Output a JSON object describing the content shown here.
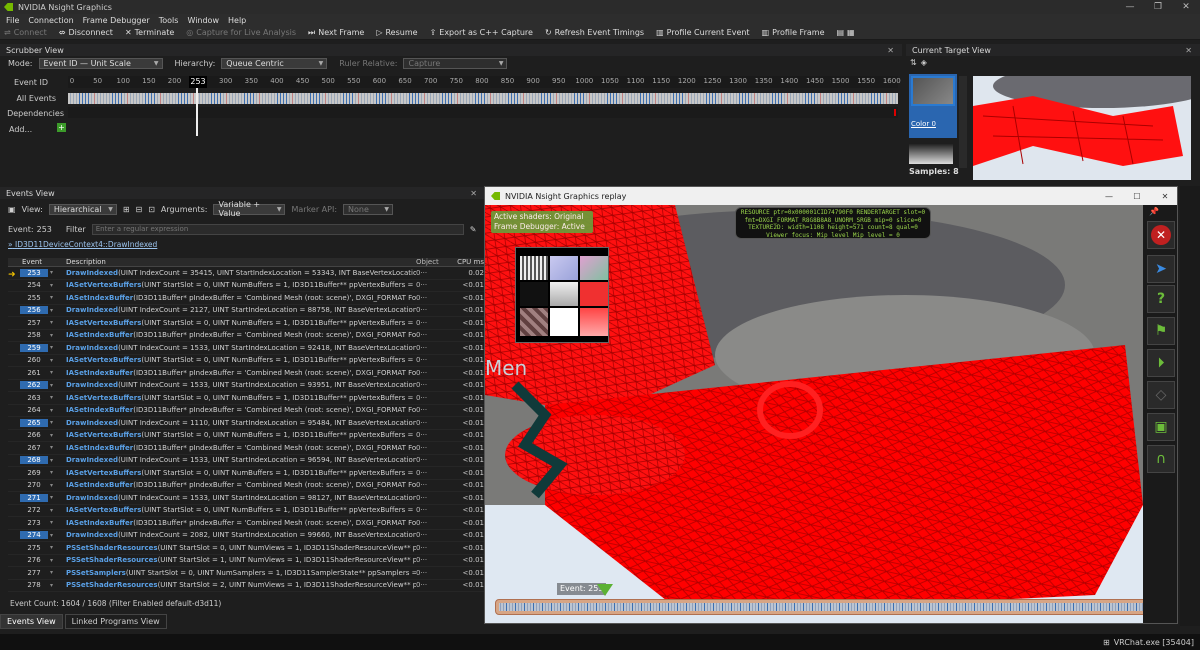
{
  "app": {
    "title": "NVIDIA Nsight Graphics"
  },
  "menu": [
    "File",
    "Connection",
    "Frame Debugger",
    "Tools",
    "Window",
    "Help"
  ],
  "toolbar": {
    "connect": "Connect",
    "disconnect": "Disconnect",
    "terminate": "Terminate",
    "capture": "Capture for Live Analysis",
    "next_frame": "Next Frame",
    "resume": "Resume",
    "export": "Export as C++ Capture",
    "refresh": "Refresh Event Timings",
    "profile_event": "Profile Current Event",
    "profile_frame": "Profile Frame"
  },
  "scrubber": {
    "title": "Scrubber View",
    "mode_label": "Mode:",
    "mode_value": "Event ID — Unit Scale",
    "hierarchy_label": "Hierarchy:",
    "hierarchy_value": "Queue Centric",
    "ruler_label": "Ruler Relative:",
    "ruler_value": "Capture",
    "rows": {
      "event_id": "Event ID",
      "all_events": "All Events",
      "dependencies": "Dependencies",
      "add": "Add..."
    },
    "ticks": [
      "0",
      "50",
      "100",
      "150",
      "200",
      "253",
      "300",
      "350",
      "400",
      "450",
      "500",
      "550",
      "600",
      "650",
      "700",
      "750",
      "800",
      "850",
      "900",
      "950",
      "1000",
      "1050",
      "1100",
      "1150",
      "1200",
      "1250",
      "1300",
      "1350",
      "1400",
      "1450",
      "1500",
      "1550",
      "1600"
    ],
    "current": "253",
    "add_button": "+"
  },
  "current_target": {
    "title": "Current Target View",
    "thumb_label": "Color 0",
    "samples": "Samples: 8"
  },
  "events_view": {
    "title": "Events View",
    "view_label": "View:",
    "view_value": "Hierarchical",
    "args_label": "Arguments:",
    "args_value": "Variable + Value",
    "marker_label": "Marker API:",
    "marker_value": "None",
    "event_label": "Event:",
    "event_value": "253",
    "filter_label": "Filter",
    "filter_placeholder": "Enter a regular expression",
    "breadcrumb": "ID3D11DeviceContext4::DrawIndexed",
    "headers": {
      "event": "Event",
      "desc": "Description",
      "object": "Object",
      "cpu": "CPU ms"
    },
    "rows": [
      {
        "id": "253",
        "sel": true,
        "fn": "DrawIndexed",
        "args": "(UINT IndexCount = 35415, UINT StartIndexLocation = 53343, INT BaseVertexLocation = ···",
        "obj": "0···",
        "cpu": "0.02"
      },
      {
        "id": "254",
        "sel": false,
        "fn": "IASetVertexBuffers",
        "args": "(UINT StartSlot = 0, UINT NumBuffers = 1, ID3D11Buffer** ppVertexBuffers = ···",
        "obj": "0···",
        "cpu": "<0.01"
      },
      {
        "id": "255",
        "sel": false,
        "fn": "IASetIndexBuffer",
        "args": "(ID3D11Buffer* pIndexBuffer = 'Combined Mesh (root: scene)', DXGI_FORMAT For···",
        "obj": "0···",
        "cpu": "<0.01"
      },
      {
        "id": "256",
        "sel": true,
        "fn": "DrawIndexed",
        "args": "(UINT IndexCount = 2127, UINT StartIndexLocation = 88758, INT BaseVertexLocation = ···",
        "obj": "0···",
        "cpu": "<0.01"
      },
      {
        "id": "257",
        "sel": false,
        "fn": "IASetVertexBuffers",
        "args": "(UINT StartSlot = 0, UINT NumBuffers = 1, ID3D11Buffer** ppVertexBuffers = ···",
        "obj": "0···",
        "cpu": "<0.01"
      },
      {
        "id": "258",
        "sel": false,
        "fn": "IASetIndexBuffer",
        "args": "(ID3D11Buffer* pIndexBuffer = 'Combined Mesh (root: scene)', DXGI_FORMAT For···",
        "obj": "0···",
        "cpu": "<0.01"
      },
      {
        "id": "259",
        "sel": true,
        "fn": "DrawIndexed",
        "args": "(UINT IndexCount = 1533, UINT StartIndexLocation = 92418, INT BaseVertexLocation = ···",
        "obj": "0···",
        "cpu": "<0.01"
      },
      {
        "id": "260",
        "sel": false,
        "fn": "IASetVertexBuffers",
        "args": "(UINT StartSlot = 0, UINT NumBuffers = 1, ID3D11Buffer** ppVertexBuffers = ···",
        "obj": "0···",
        "cpu": "<0.01"
      },
      {
        "id": "261",
        "sel": false,
        "fn": "IASetIndexBuffer",
        "args": "(ID3D11Buffer* pIndexBuffer = 'Combined Mesh (root: scene)', DXGI_FORMAT For···",
        "obj": "0···",
        "cpu": "<0.01"
      },
      {
        "id": "262",
        "sel": true,
        "fn": "DrawIndexed",
        "args": "(UINT IndexCount = 1533, UINT StartIndexLocation = 93951, INT BaseVertexLocation = ···",
        "obj": "0···",
        "cpu": "<0.01"
      },
      {
        "id": "263",
        "sel": false,
        "fn": "IASetVertexBuffers",
        "args": "(UINT StartSlot = 0, UINT NumBuffers = 1, ID3D11Buffer** ppVertexBuffers = ···",
        "obj": "0···",
        "cpu": "<0.01"
      },
      {
        "id": "264",
        "sel": false,
        "fn": "IASetIndexBuffer",
        "args": "(ID3D11Buffer* pIndexBuffer = 'Combined Mesh (root: scene)', DXGI_FORMAT For···",
        "obj": "0···",
        "cpu": "<0.01"
      },
      {
        "id": "265",
        "sel": true,
        "fn": "DrawIndexed",
        "args": "(UINT IndexCount = 1110, UINT StartIndexLocation = 95484, INT BaseVertexLocation = ···",
        "obj": "0···",
        "cpu": "<0.01"
      },
      {
        "id": "266",
        "sel": false,
        "fn": "IASetVertexBuffers",
        "args": "(UINT StartSlot = 0, UINT NumBuffers = 1, ID3D11Buffer** ppVertexBuffers = ···",
        "obj": "0···",
        "cpu": "<0.01"
      },
      {
        "id": "267",
        "sel": false,
        "fn": "IASetIndexBuffer",
        "args": "(ID3D11Buffer* pIndexBuffer = 'Combined Mesh (root: scene)', DXGI_FORMAT For···",
        "obj": "0···",
        "cpu": "<0.01"
      },
      {
        "id": "268",
        "sel": true,
        "fn": "DrawIndexed",
        "args": "(UINT IndexCount = 1533, UINT StartIndexLocation = 96594, INT BaseVertexLocation = ···",
        "obj": "0···",
        "cpu": "<0.01"
      },
      {
        "id": "269",
        "sel": false,
        "fn": "IASetVertexBuffers",
        "args": "(UINT StartSlot = 0, UINT NumBuffers = 1, ID3D11Buffer** ppVertexBuffers = ···",
        "obj": "0···",
        "cpu": "<0.01"
      },
      {
        "id": "270",
        "sel": false,
        "fn": "IASetIndexBuffer",
        "args": "(ID3D11Buffer* pIndexBuffer = 'Combined Mesh (root: scene)', DXGI_FORMAT For···",
        "obj": "0···",
        "cpu": "<0.01"
      },
      {
        "id": "271",
        "sel": true,
        "fn": "DrawIndexed",
        "args": "(UINT IndexCount = 1533, UINT StartIndexLocation = 98127, INT BaseVertexLocation = ···",
        "obj": "0···",
        "cpu": "<0.01"
      },
      {
        "id": "272",
        "sel": false,
        "fn": "IASetVertexBuffers",
        "args": "(UINT StartSlot = 0, UINT NumBuffers = 1, ID3D11Buffer** ppVertexBuffers = ···",
        "obj": "0···",
        "cpu": "<0.01"
      },
      {
        "id": "273",
        "sel": false,
        "fn": "IASetIndexBuffer",
        "args": "(ID3D11Buffer* pIndexBuffer = 'Combined Mesh (root: scene)', DXGI_FORMAT For···",
        "obj": "0···",
        "cpu": "<0.01"
      },
      {
        "id": "274",
        "sel": true,
        "fn": "DrawIndexed",
        "args": "(UINT IndexCount = 2082, UINT StartIndexLocation = 99660, INT BaseVertexLocation = ···",
        "obj": "0···",
        "cpu": "<0.01"
      },
      {
        "id": "275",
        "sel": false,
        "fn": "PSSetShaderResources",
        "args": "(UINT StartSlot = 0, UINT NumViews = 1, ID3D11ShaderResourceView** pp···",
        "obj": "0···",
        "cpu": "<0.01"
      },
      {
        "id": "276",
        "sel": false,
        "fn": "PSSetShaderResources",
        "args": "(UINT StartSlot = 1, UINT NumViews = 1, ID3D11ShaderResourceView** pp···",
        "obj": "0···",
        "cpu": "<0.01"
      },
      {
        "id": "277",
        "sel": false,
        "fn": "PSSetSamplers",
        "args": "(UINT StartSlot = 0, UINT NumSamplers = 1, ID3D11SamplerState** ppSamplers = ···",
        "obj": "0···",
        "cpu": "<0.01"
      },
      {
        "id": "278",
        "sel": false,
        "fn": "PSSetShaderResources",
        "args": "(UINT StartSlot = 2, UINT NumViews = 1, ID3D11ShaderResourceView** pp···",
        "obj": "0···",
        "cpu": "<0.01"
      }
    ],
    "count": "Event Count: 1604 / 1608 (Filter Enabled default-d3d11)"
  },
  "bottom_tabs": [
    "Events View",
    "Linked Programs View"
  ],
  "replay": {
    "title": "NVIDIA Nsight Graphics replay",
    "badge_line1": "Active shaders: Original",
    "badge_line2": "Frame Debugger: Active",
    "res_line1": "RESOURCE ptr=0x000001CID74790F0 RENDERTARGET slot=0",
    "res_line2": "fmt=DXGI_FORMAT_R8G8B8A8_UNORM_SRGB mip=0 slice=0",
    "res_line3": "TEXTURE2D: width=1108 height=571 count=8 qual=0",
    "res_line4": "Viewer focus: Mip level Mip level = 0",
    "event_label": "Event: 253",
    "scene_text": "Men"
  },
  "status": {
    "text": "VRChat.exe [35404]"
  },
  "colors": {
    "accent": "#76b900",
    "select": "#2f6bb0",
    "wire": "#ff0000",
    "fn": "#5aa0e6"
  }
}
